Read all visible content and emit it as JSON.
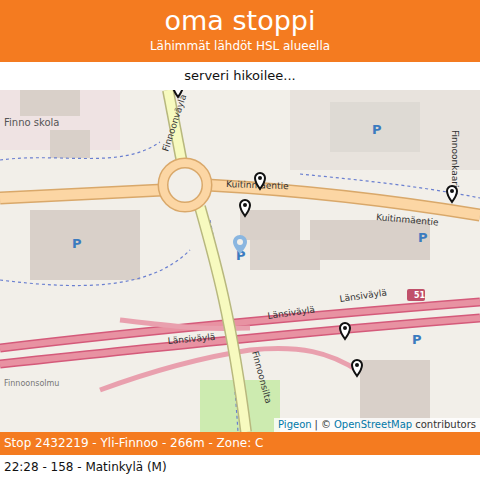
{
  "header": {
    "title": "oma stoppi",
    "subtitle": "Lähimmät lähdöt HSL alueella"
  },
  "status": "serveri hikoilee...",
  "map": {
    "labels": [
      {
        "text": "Finno skola"
      },
      {
        "text": "Finnoonväylä"
      },
      {
        "text": "Kuitinmäentie"
      },
      {
        "text": "Kuitinmäentie"
      },
      {
        "text": "Länsiväylä"
      },
      {
        "text": "Länsiväylä"
      },
      {
        "text": "Länsiväylä"
      },
      {
        "text": "51"
      },
      {
        "text": "Finnoonsolmu"
      },
      {
        "text": "Finnoonsilta"
      },
      {
        "text": "Finnoonkaari"
      }
    ],
    "parking": "P",
    "attribution": {
      "provider": "Pigeon",
      "separator": "|",
      "copyright": "©",
      "osm": "OpenStreetMap",
      "contributors": "contributors"
    }
  },
  "stop": {
    "title": "Stop 2432219 - Yli-Finnoo - 266m - Zone: C"
  },
  "departures": [
    {
      "text": "22:28 - 158 - Matinkylä (M)"
    }
  ]
}
